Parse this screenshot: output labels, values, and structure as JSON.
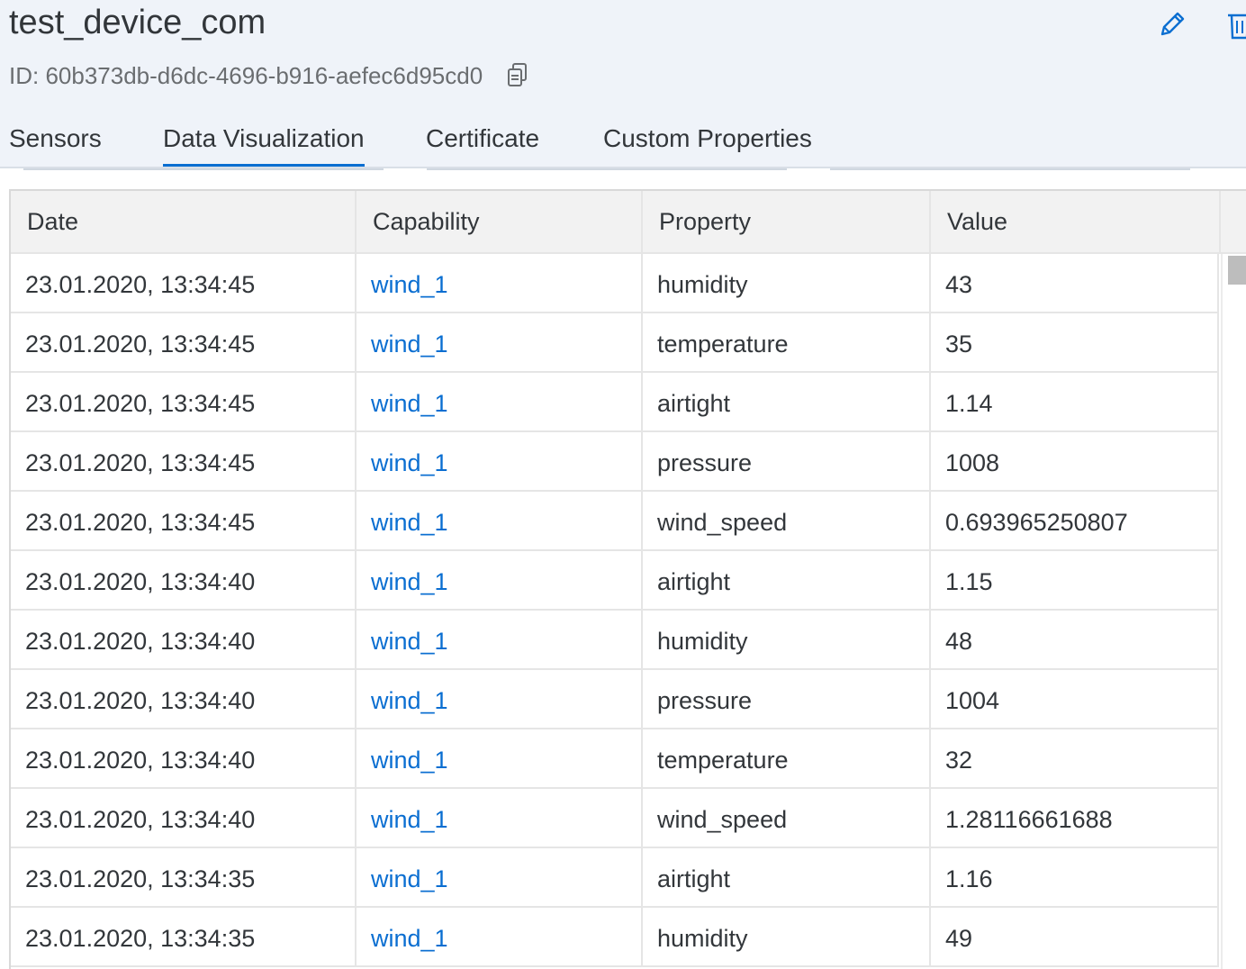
{
  "device": {
    "name": "test_device_com",
    "id_text": "ID: 60b373db-d6dc-4696-b916-aefec6d95cd0"
  },
  "icons": {
    "copy": "copy-icon",
    "edit": "pencil-icon",
    "delete": "trash-icon"
  },
  "tabs": [
    {
      "label": "Sensors",
      "active": false
    },
    {
      "label": "Data Visualization",
      "active": true
    },
    {
      "label": "Certificate",
      "active": false
    },
    {
      "label": "Custom Properties",
      "active": false
    }
  ],
  "table": {
    "columns": [
      "Date",
      "Capability",
      "Property",
      "Value"
    ],
    "rows": [
      [
        "23.01.2020, 13:34:45",
        "wind_1",
        "humidity",
        "43"
      ],
      [
        "23.01.2020, 13:34:45",
        "wind_1",
        "temperature",
        "35"
      ],
      [
        "23.01.2020, 13:34:45",
        "wind_1",
        "airtight",
        "1.14"
      ],
      [
        "23.01.2020, 13:34:45",
        "wind_1",
        "pressure",
        "1008"
      ],
      [
        "23.01.2020, 13:34:45",
        "wind_1",
        "wind_speed",
        "0.693965250807"
      ],
      [
        "23.01.2020, 13:34:40",
        "wind_1",
        "airtight",
        "1.15"
      ],
      [
        "23.01.2020, 13:34:40",
        "wind_1",
        "humidity",
        "48"
      ],
      [
        "23.01.2020, 13:34:40",
        "wind_1",
        "pressure",
        "1004"
      ],
      [
        "23.01.2020, 13:34:40",
        "wind_1",
        "temperature",
        "32"
      ],
      [
        "23.01.2020, 13:34:40",
        "wind_1",
        "wind_speed",
        "1.28116661688"
      ],
      [
        "23.01.2020, 13:34:35",
        "wind_1",
        "airtight",
        "1.16"
      ],
      [
        "23.01.2020, 13:34:35",
        "wind_1",
        "humidity",
        "49"
      ]
    ]
  },
  "colors": {
    "header_bg": "#eff3f9",
    "link": "#0a6ed1",
    "active_tab_underline": "#0a6ed1",
    "text": "#32363a",
    "muted_text": "#6a6d70"
  }
}
